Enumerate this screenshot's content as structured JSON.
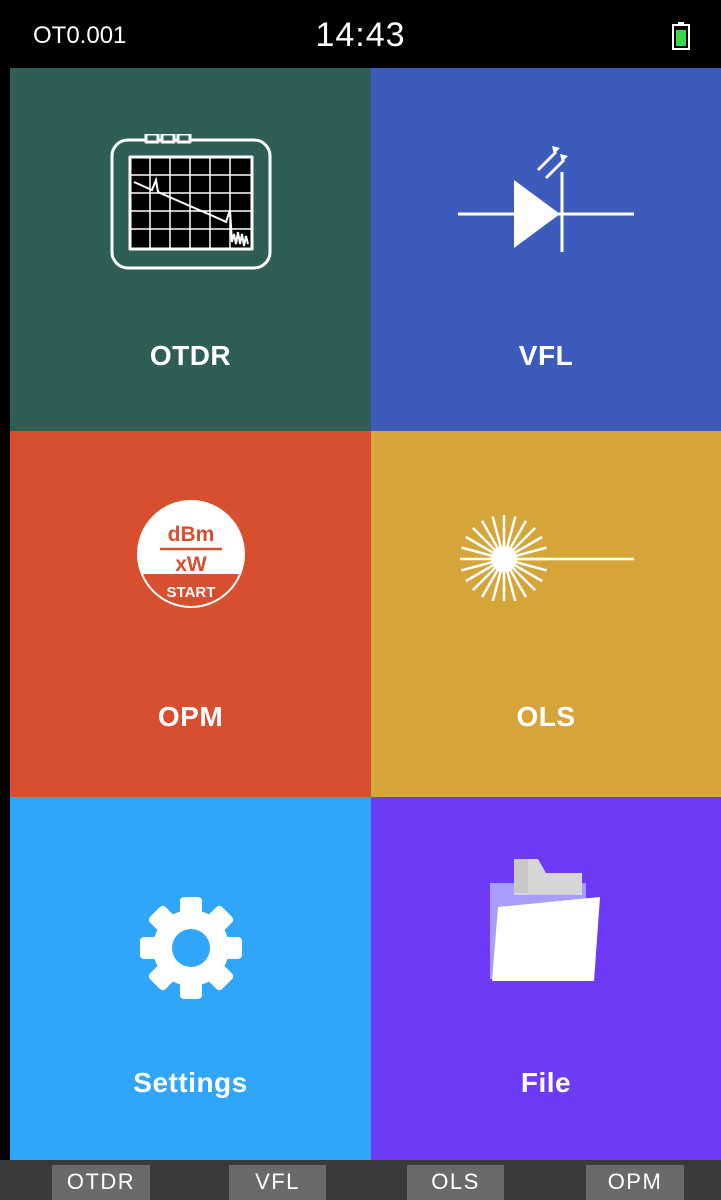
{
  "status": {
    "device_id": "OT0.001",
    "time": "14:43",
    "battery_icon": "battery-icon"
  },
  "tiles": [
    {
      "label": "OTDR",
      "color": "#2e5e56",
      "icon": "otdr-icon"
    },
    {
      "label": "VFL",
      "color": "#3c5bbd",
      "icon": "laser-diode-icon"
    },
    {
      "label": "OPM",
      "color": "#d74f2e",
      "icon": "power-meter-icon",
      "icon_text": {
        "unit1": "dBm",
        "unit2": "xW",
        "button": "START"
      }
    },
    {
      "label": "OLS",
      "color": "#d6a53a",
      "icon": "light-source-icon"
    },
    {
      "label": "Settings",
      "color": "#2fa6f9",
      "icon": "gear-icon"
    },
    {
      "label": "File",
      "color": "#6d3af8",
      "icon": "folder-icon"
    }
  ],
  "bottom_nav": [
    "OTDR",
    "VFL",
    "OLS",
    "OPM"
  ]
}
